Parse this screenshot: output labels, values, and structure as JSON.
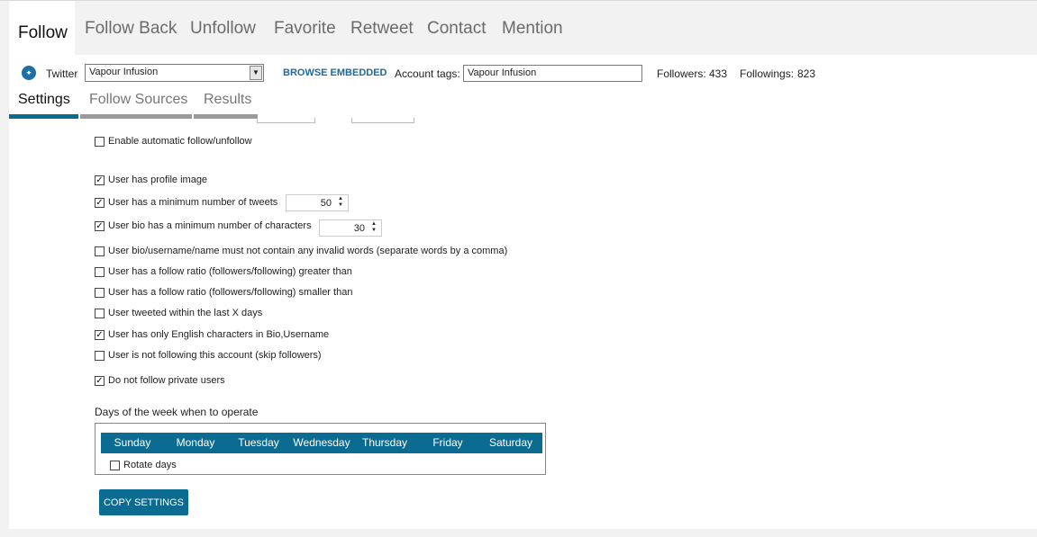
{
  "main_tabs": [
    "Follow",
    "Follow Back",
    "Unfollow",
    "Favorite",
    "Retweet",
    "Contact",
    "Mention"
  ],
  "account": {
    "network_label": "Twitter",
    "selected_account": "Vapour Infusion",
    "browse_label": "BROWSE EMBEDDED",
    "tags_label": "Account tags:",
    "tags_value": "Vapour Infusion",
    "followers_label": "Followers:",
    "followers_value": "433",
    "followings_label": "Followings:",
    "followings_value": "823"
  },
  "sub_tabs": [
    "Settings",
    "Follow Sources",
    "Results"
  ],
  "options": {
    "auto": {
      "label": "Enable automatic follow/unfollow",
      "checked": false
    },
    "profile_image": {
      "label": "User has profile image",
      "checked": true
    },
    "min_tweets": {
      "label": "User has a minimum number of tweets",
      "checked": true,
      "value": "50"
    },
    "min_bio": {
      "label": "User bio has a minimum number of characters",
      "checked": true,
      "value": "30"
    },
    "invalid_words": {
      "label": "User bio/username/name must not contain any invalid words (separate words by a comma)",
      "checked": false
    },
    "ratio_greater": {
      "label": "User has a follow ratio (followers/following) greater than",
      "checked": false
    },
    "ratio_smaller": {
      "label": "User has a follow ratio (followers/following) smaller than",
      "checked": false
    },
    "tweeted_within": {
      "label": "User tweeted within the last X days",
      "checked": false
    },
    "english_only": {
      "label": "User has only English characters in Bio,Username",
      "checked": true
    },
    "not_following": {
      "label": "User is not following this account (skip followers)",
      "checked": false
    },
    "private_users": {
      "label": "Do not follow private users",
      "checked": true
    }
  },
  "days": {
    "label": "Days of the week when to operate",
    "names": [
      "Sunday",
      "Monday",
      "Tuesday",
      "Wednesday",
      "Thursday",
      "Friday",
      "Saturday"
    ],
    "rotate_label": "Rotate days",
    "rotate_checked": false
  },
  "copy_button": "COPY SETTINGS",
  "colors": {
    "accent": "#0b6b91",
    "link": "#1e6a99",
    "twitter": "#1d6fa5"
  }
}
